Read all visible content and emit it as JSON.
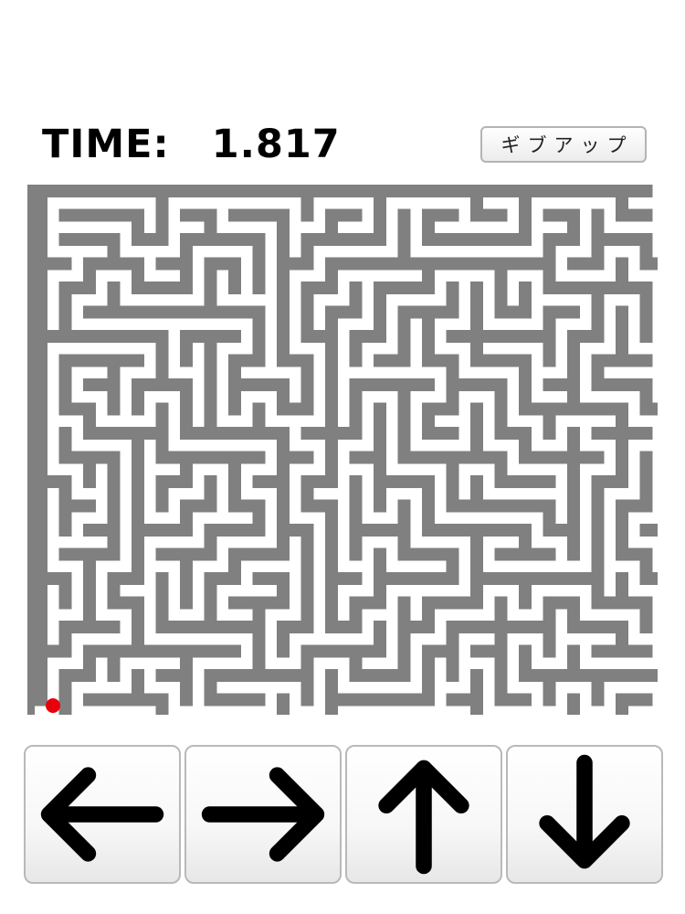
{
  "timer": {
    "label": "TIME:",
    "value": "1.817"
  },
  "give_up_button": {
    "label": "ギブアップ"
  },
  "maze": {
    "wall_color": "#808080",
    "path_color": "#ffffff",
    "player_color": "#e8000b"
  },
  "controls": [
    {
      "name": "left-arrow-button",
      "icon": "arrow-left-icon"
    },
    {
      "name": "right-arrow-button",
      "icon": "arrow-right-icon"
    },
    {
      "name": "up-arrow-button",
      "icon": "arrow-up-icon"
    },
    {
      "name": "down-arrow-button",
      "icon": "arrow-down-icon"
    }
  ]
}
